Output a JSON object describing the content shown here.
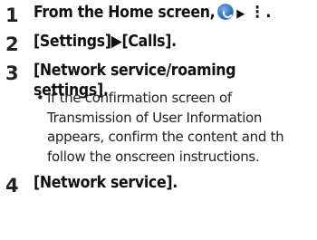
{
  "steps": [
    {
      "num": "1",
      "text_before": "From the Home screen,",
      "icon": "phone-icon",
      "arrow": "▶",
      "menu": "⋮",
      "text_after": "."
    },
    {
      "num": "2",
      "text": "[Settings]▶[Calls]."
    },
    {
      "num": "3",
      "line1": "[Network service/roaming",
      "line2": "settings].",
      "note": {
        "bullet": "•",
        "lines": [
          "If the confirmation screen of",
          "Transmission of User Information",
          "appears, confirm the content and th",
          "follow the onscreen instructions."
        ]
      }
    },
    {
      "num": "4",
      "text": "[Network service]."
    }
  ]
}
